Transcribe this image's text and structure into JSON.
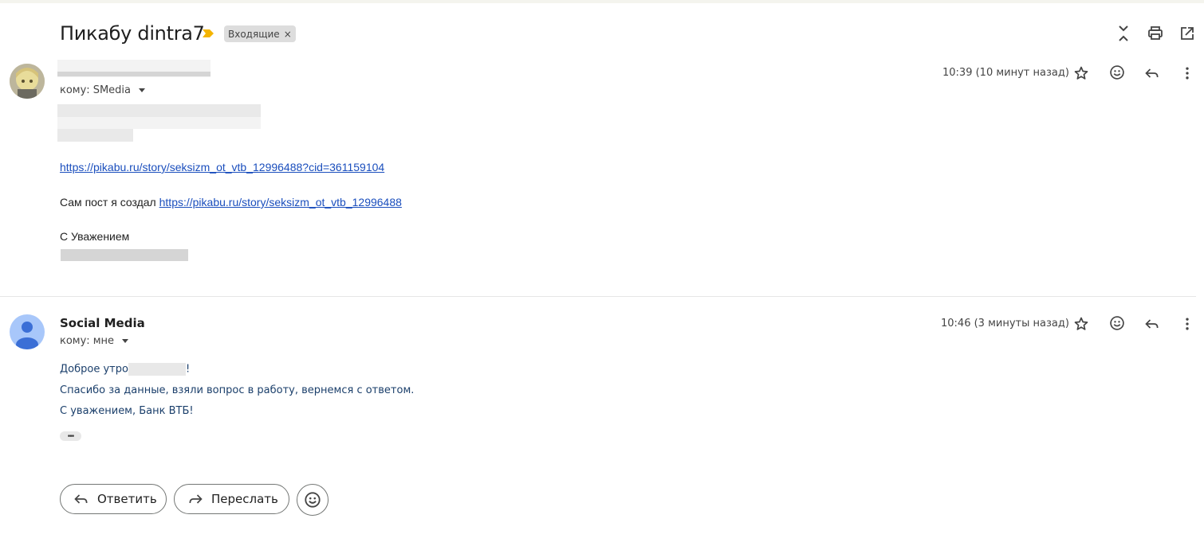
{
  "thread": {
    "subject": "Пикабу dintra7",
    "label": "Входящие",
    "label_remove": "×"
  },
  "message1": {
    "to_prefix": "кому:",
    "to": "SMedia",
    "time": "10:39 (10 минут назад)",
    "link1": "https://pikabu.ru/story/seksizm_ot_vtb_12996488?cid=361159104",
    "post_text": "Сам пост я создал",
    "link2": "https://pikabu.ru/story/seksizm_ot_vtb_12996488",
    "sign": "С Уважением"
  },
  "message2": {
    "sender": "Social Media",
    "to_prefix": "кому:",
    "to": "мне",
    "time": "10:46 (3 минуты назад)",
    "greeting": "Доброе утро",
    "greeting_end": "!",
    "line2": "Спасибо за данные, взяли вопрос в работу, вернемся с ответом.",
    "line3": "С уважением, Банк ВТБ!",
    "dots": "•••"
  },
  "actions": {
    "reply": "Ответить",
    "forward": "Переслать"
  },
  "icons": {
    "important": "importance-marker-icon",
    "collapse": "collapse-all-icon",
    "print": "print-icon",
    "open_new": "open-in-new-window-icon",
    "star": "star-icon",
    "emoji": "emoji-icon",
    "reply": "reply-icon",
    "more": "more-vert-icon",
    "forward": "forward-icon"
  },
  "colors": {
    "link": "#1a4ebd",
    "bank_text": "#1b3f6b",
    "important": "#f4b400",
    "avatar_blue": "#a8c7fa"
  }
}
